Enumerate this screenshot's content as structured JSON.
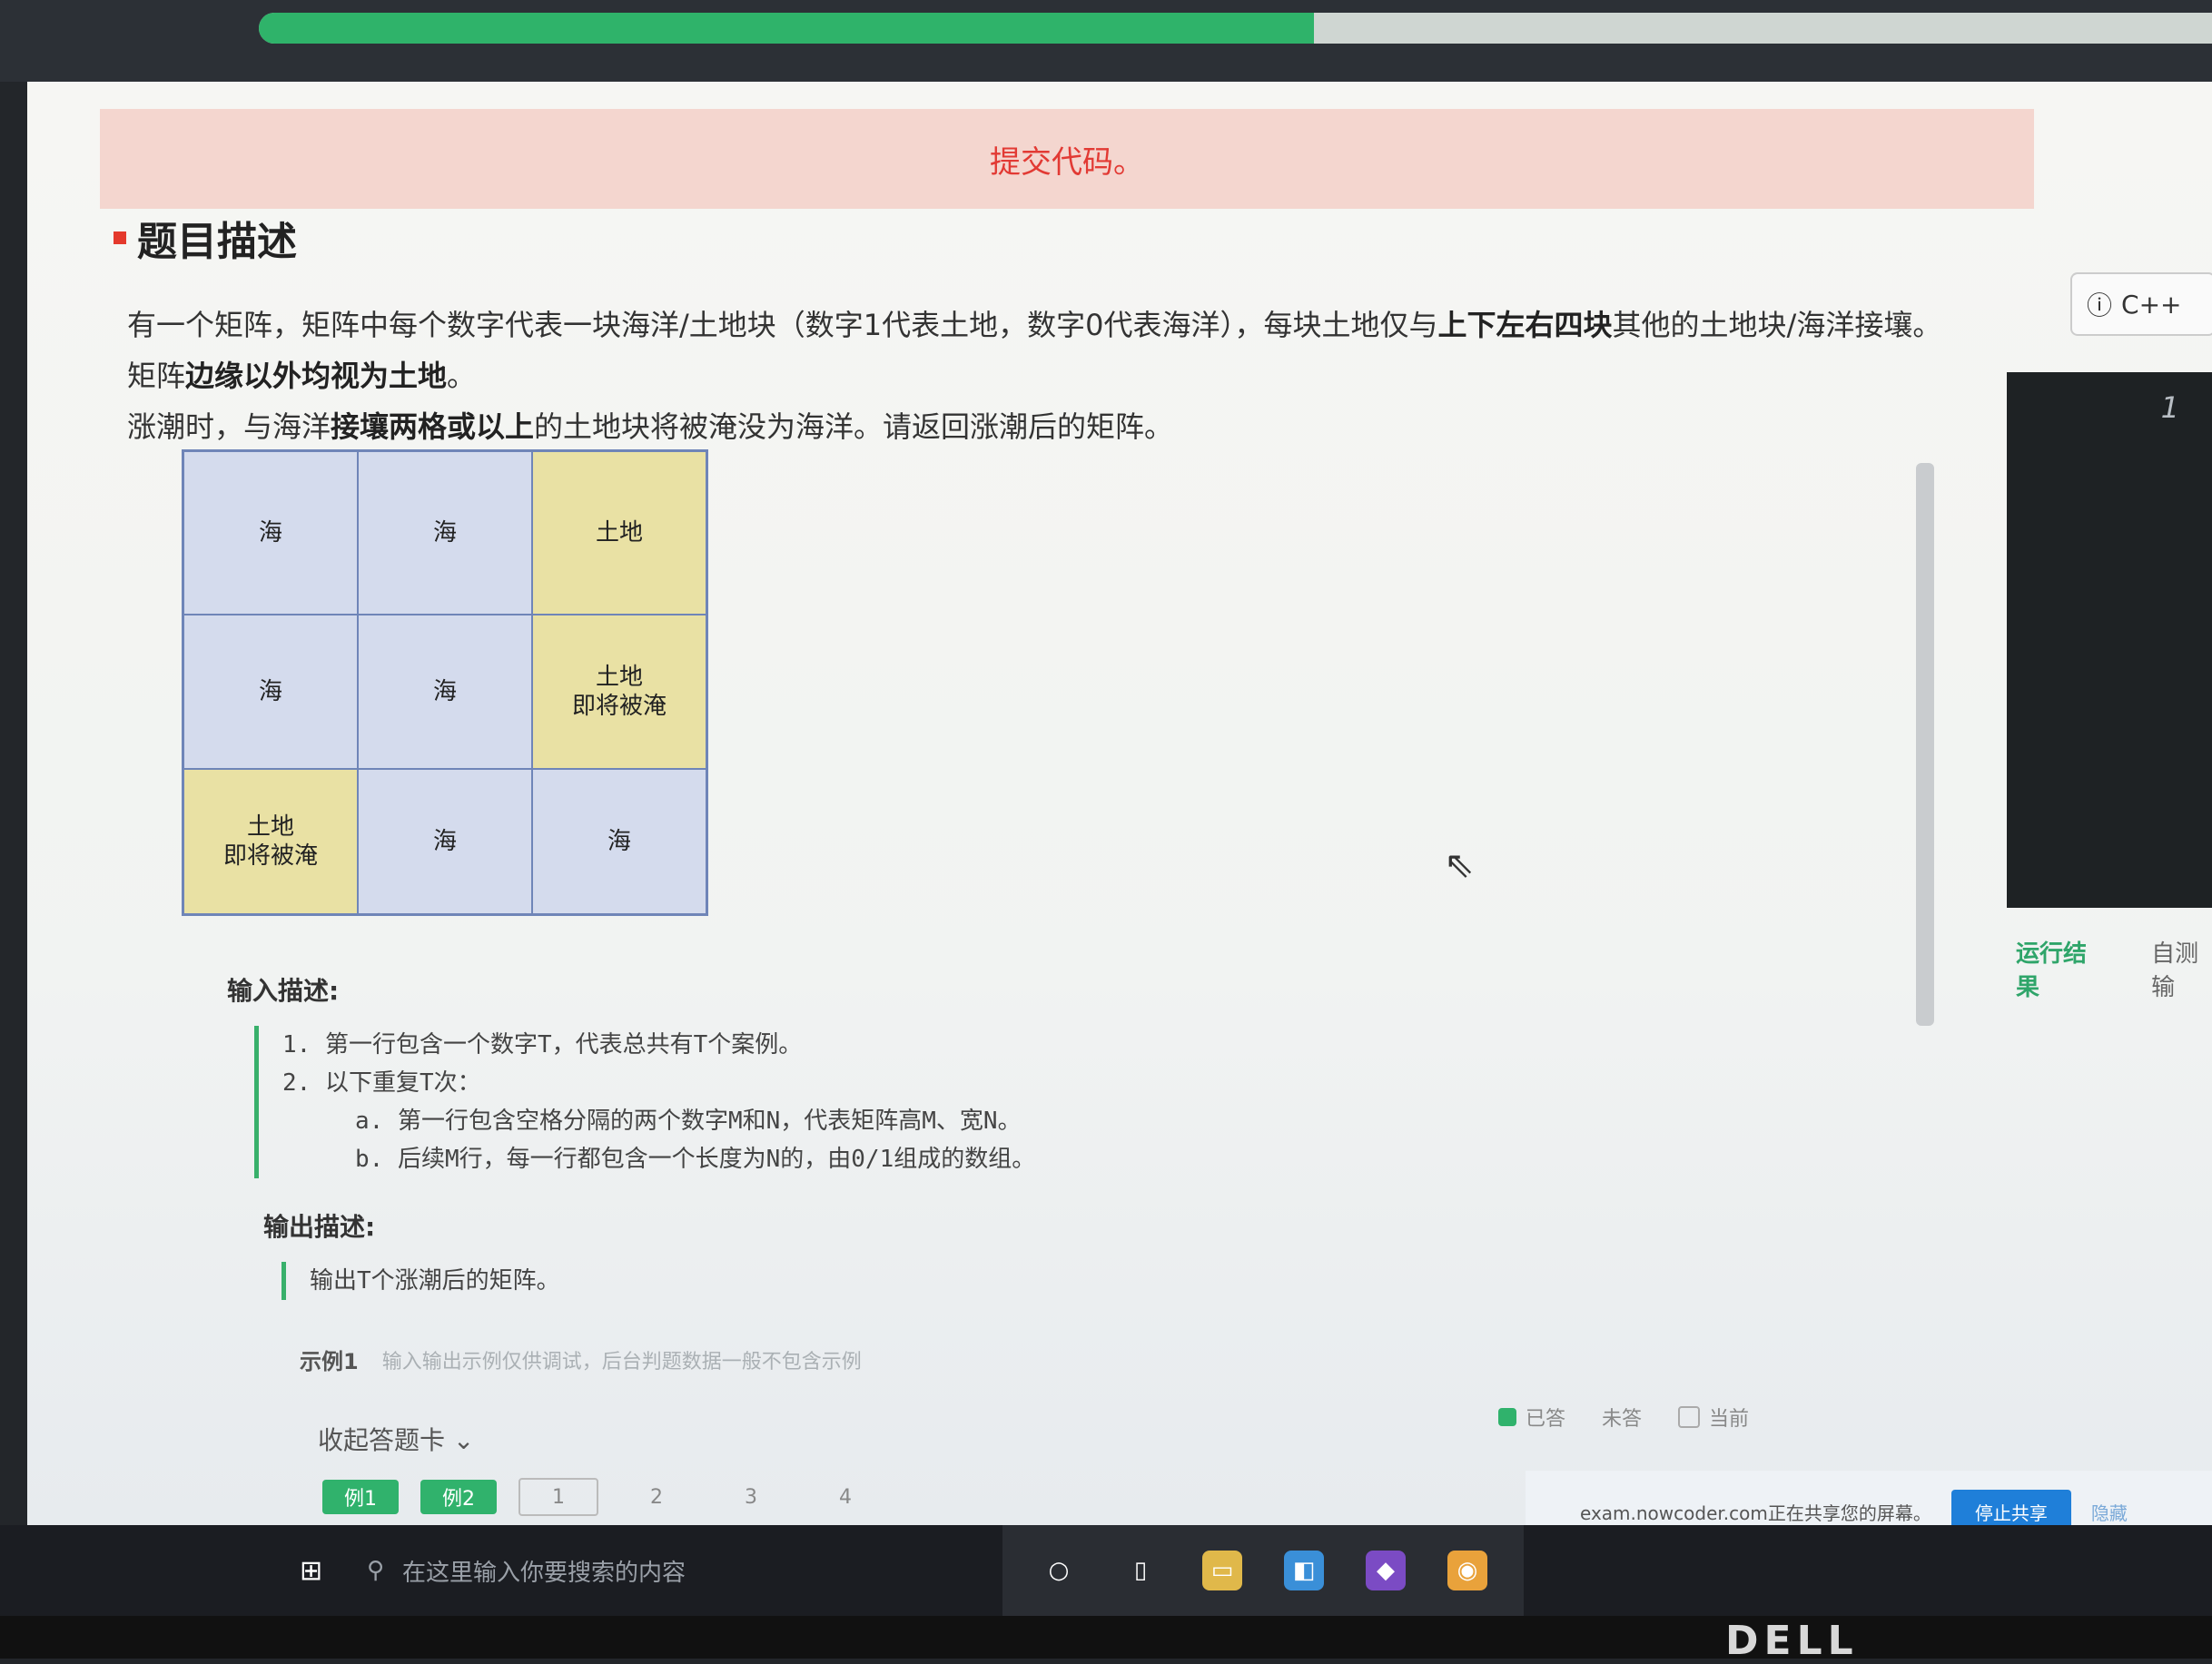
{
  "progress": {
    "fraction": 0.54
  },
  "banner": {
    "submit": "提交代码。"
  },
  "problem": {
    "title": "题目描述",
    "desc_line1_a": "有一个矩阵，矩阵中每个数字代表一块海洋/土地块（数字1代表土地，数字0代表海洋），每块土地仅与",
    "desc_line1_b": "上下左右四块",
    "desc_line1_c": "其他的土地块/海洋接壤。",
    "desc_line2_a": "矩阵",
    "desc_line2_b": "边缘以外均视为土地",
    "desc_line2_c": "。",
    "desc_line3_a": "涨潮时，与海洋",
    "desc_line3_b": "接壤两格或以上",
    "desc_line3_c": "的土地块将被淹没为海洋。请返回涨潮后的矩阵。",
    "grid": {
      "r1c1": "海",
      "r1c2": "海",
      "r1c3": "土地",
      "r2c1": "海",
      "r2c2": "海",
      "r2c3a": "土地",
      "r2c3b": "即将被淹",
      "r3c1a": "土地",
      "r3c1b": "即将被淹",
      "r3c2": "海",
      "r3c3": "海"
    },
    "input_title": "输入描述:",
    "input_1": "1. 第一行包含一个数字T，代表总共有T个案例。",
    "input_2": "2. 以下重复T次：",
    "input_2a": "a. 第一行包含空格分隔的两个数字M和N，代表矩阵高M、宽N。",
    "input_2b": "b. 后续M行，每一行都包含一个长度为N的，由0/1组成的数组。",
    "output_title": "输出描述:",
    "output_1": "输出T个涨潮后的矩阵。",
    "example_label": "示例1",
    "example_hint": "输入输出示例仅供调试，后台判题数据一般不包含示例"
  },
  "answer_card": {
    "collapse": "收起答题卡",
    "legend_done": "已答",
    "legend_todo": "未答",
    "legend_current": "当前",
    "buttons": [
      "例1",
      "例2",
      "1",
      "2",
      "3",
      "4"
    ]
  },
  "share": {
    "text": "exam.nowcoder.com正在共享您的屏幕。",
    "stop": "停止共享",
    "hide": "隐藏"
  },
  "editor": {
    "language": "C++",
    "line_number": "1",
    "tab_run": "运行结果",
    "tab_self": "自测输"
  },
  "taskbar": {
    "search_placeholder": "在这里输入你要搜索的内容"
  },
  "monitor": {
    "brand": "DELL"
  },
  "colors": {
    "accent": "#30b26c",
    "sea": "#d4dbed",
    "land": "#e9e1a4",
    "alert": "#e23a34"
  }
}
